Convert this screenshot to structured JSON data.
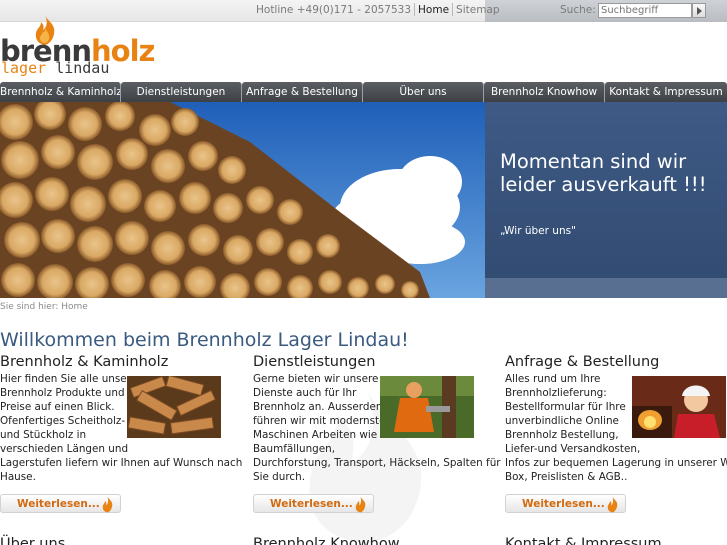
{
  "header": {
    "hotline": "Hotline +49(0)171 - 2057533",
    "links": [
      {
        "label": "Home"
      },
      {
        "label": "Sitemap"
      }
    ],
    "search": {
      "label": "Suche:",
      "placeholder": "Suchbegriff"
    }
  },
  "logo": {
    "brenn": "brenn",
    "holz": "holz",
    "lager": "lager",
    "lindau": "lindau"
  },
  "nav": [
    {
      "label": "Brennholz & Kaminholz"
    },
    {
      "label": "Dienstleistungen"
    },
    {
      "label": "Anfrage & Bestellung"
    },
    {
      "label": "Über uns"
    },
    {
      "label": "Brennholz Knowhow"
    },
    {
      "label": "Kontakt & Impressum"
    }
  ],
  "hero": {
    "heading": "Momentan sind wir leider ausverkauft !!!",
    "link": "„Wir über uns\""
  },
  "breadcrumb": "Sie sind hier: Home",
  "welcome": "Willkommen beim Brennholz Lager Lindau!",
  "columns": [
    {
      "title": "Brennholz & Kaminholz",
      "lines": [
        "Hier finden Sie alle unsere",
        "Brennholz Produkte und",
        "Preise auf einen Blick.",
        "Ofenfertiges Scheitholz-",
        "und Stückholz in",
        "verschieden Längen und",
        "Lagerstufen liefern wir Ihnen auf Wunsch nach",
        "Hause."
      ],
      "button": "Weiterlesen..."
    },
    {
      "title": "Dienstleistungen",
      "lines": [
        "Gerne bieten wir unsere",
        "Dienste auch für Ihr",
        "Brennholz an. Ausserdem",
        "führen wir mit modernsten",
        "Maschinen Arbeiten wie",
        "Baumfällungen,",
        "Durchforstung, Transport, Häckseln, Spalten für",
        "Sie durch."
      ],
      "button": "Weiterlesen..."
    },
    {
      "title": "Anfrage & Bestellung",
      "lines": [
        "Alles rund um Ihre",
        "Brennholzlieferung:",
        "Bestellformular für Ihre",
        "unverbindliche Online",
        "Brennholz Bestellung,",
        "Liefer-und Versandkosten,",
        "Infos zur bequemen Lagerung in unserer Woody",
        "Box, Preislisten & AGB.."
      ],
      "button": "Weiterlesen..."
    }
  ],
  "row2": [
    {
      "title": "Über uns"
    },
    {
      "title": "Brennholz Knowhow"
    },
    {
      "title": "Kontakt & Impressum"
    }
  ],
  "colors": {
    "accent": "#e88313",
    "nav_bg": "#484c50",
    "hero_panel": "#3a5580",
    "welcome": "#3a5a80"
  },
  "icons": [
    "flame-logo-icon",
    "search-arrow-icon",
    "flame-icon"
  ]
}
